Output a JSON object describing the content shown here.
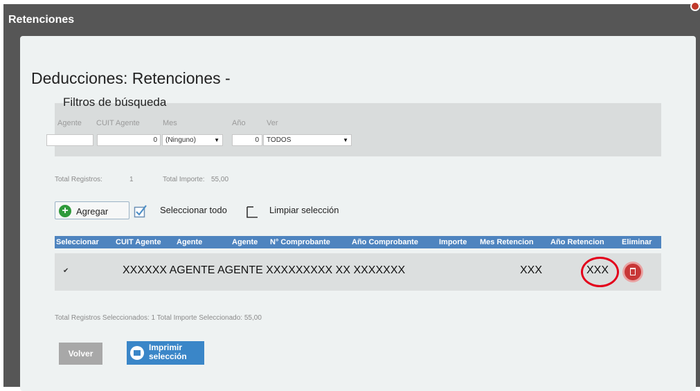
{
  "window": {
    "title": "Retenciones"
  },
  "page": {
    "title": "Deducciones: Retenciones -"
  },
  "filters": {
    "title": "Filtros de búsqueda",
    "agente": {
      "label": "Agente",
      "value": ""
    },
    "cuit": {
      "label": "CUIT Agente",
      "value": "0"
    },
    "mes": {
      "label": "Mes",
      "value": "(Ninguno)",
      "caret": "▼"
    },
    "anio": {
      "label": "Año",
      "value": "0"
    },
    "ver": {
      "label": "Ver",
      "value": "TODOS",
      "caret": "▼"
    }
  },
  "summary": {
    "total_registros_label": "Total Registros:",
    "total_registros_value": "1",
    "total_importe_label": "Total Importe:",
    "total_importe_value": "55,00"
  },
  "toolbar": {
    "add_label": "Agregar",
    "add_icon": "+",
    "select_all_label": "Seleccionar todo",
    "clear_selection_label": "Limpiar selección"
  },
  "table": {
    "columns": [
      "Seleccionar",
      "CUIT Agente",
      "Agente",
      "Agente",
      "N° Comprobante",
      "Año Comprobante",
      "Importe",
      "Mes Retencion",
      "Año Retencion",
      "Eliminar"
    ],
    "rows": [
      {
        "check": "✔",
        "main": "XXXXXX AGENTE AGENTE XXXXXXXXX XX XXXXXXX",
        "mes_retencion": "XXX",
        "anio_retencion": "XXX"
      }
    ]
  },
  "selection_summary": {
    "text": "Total Registros Seleccionados:  1 Total Importe Seleccionado:  55,00"
  },
  "buttons": {
    "back_label": "Volver",
    "print_label": "Imprimir selección"
  },
  "colors": {
    "header_blue": "#4e84bf",
    "delete_red": "#c83737",
    "highlight_red": "#e3001b",
    "add_green": "#2f9a3b"
  }
}
